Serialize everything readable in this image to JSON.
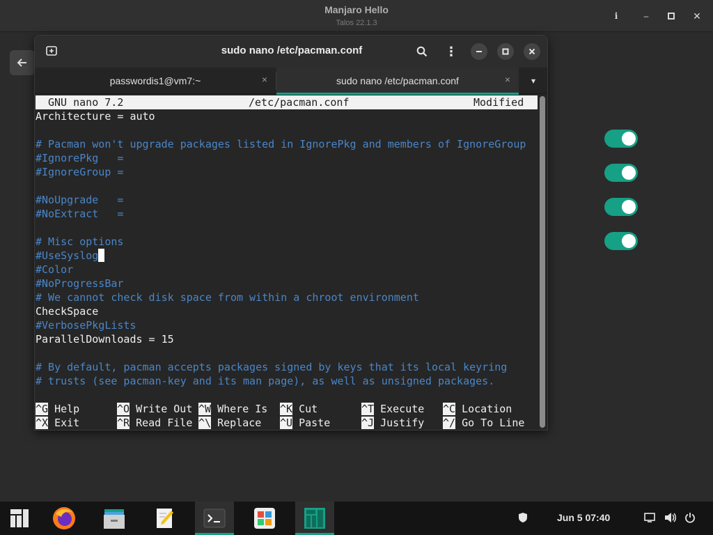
{
  "background_app": {
    "title": "Manjaro Hello",
    "subtitle": "Talos 22.1.3",
    "info_icon": "info-icon",
    "buttons": [
      "minimize-icon",
      "maximize-icon",
      "close-icon"
    ],
    "back_icon": "arrow-left-icon",
    "toggles": [
      true,
      true,
      true,
      true
    ],
    "accent_color": "#16a085"
  },
  "terminal": {
    "title": "sudo nano /etc/pacman.conf",
    "tabs": [
      {
        "label": "passwordis1@vm7:~",
        "active": false
      },
      {
        "label": "sudo nano /etc/pacman.conf",
        "active": true
      }
    ],
    "close_glyph": "×",
    "menu_glyph": "⋮",
    "dropdown_glyph": "▾"
  },
  "nano": {
    "version": "GNU nano 7.2",
    "filename": "/etc/pacman.conf",
    "status": "Modified",
    "lines": [
      {
        "text": "Architecture = auto",
        "comment": false
      },
      {
        "text": "",
        "comment": false
      },
      {
        "text": "# Pacman won't upgrade packages listed in IgnorePkg and members of IgnoreGroup",
        "comment": true
      },
      {
        "text": "#IgnorePkg   =",
        "comment": true
      },
      {
        "text": "#IgnoreGroup =",
        "comment": true
      },
      {
        "text": "",
        "comment": false
      },
      {
        "text": "#NoUpgrade   =",
        "comment": true
      },
      {
        "text": "#NoExtract   =",
        "comment": true
      },
      {
        "text": "",
        "comment": false
      },
      {
        "text": "# Misc options",
        "comment": true
      },
      {
        "text": "#UseSyslog",
        "comment": true,
        "cursor": true
      },
      {
        "text": "#Color",
        "comment": true
      },
      {
        "text": "#NoProgressBar",
        "comment": true
      },
      {
        "text": "# We cannot check disk space from within a chroot environment",
        "comment": true
      },
      {
        "text": "CheckSpace",
        "comment": false
      },
      {
        "text": "#VerbosePkgLists",
        "comment": true
      },
      {
        "text": "ParallelDownloads = 15",
        "comment": false
      },
      {
        "text": "",
        "comment": false
      },
      {
        "text": "# By default, pacman accepts packages signed by keys that its local keyring",
        "comment": true
      },
      {
        "text": "# trusts (see pacman-key and its man page), as well as unsigned packages.",
        "comment": true
      }
    ],
    "shortcuts_row1": [
      {
        "key": "^G",
        "label": "Help"
      },
      {
        "key": "^O",
        "label": "Write Out"
      },
      {
        "key": "^W",
        "label": "Where Is"
      },
      {
        "key": "^K",
        "label": "Cut"
      },
      {
        "key": "^T",
        "label": "Execute"
      },
      {
        "key": "^C",
        "label": "Location"
      }
    ],
    "shortcuts_row2": [
      {
        "key": "^X",
        "label": "Exit"
      },
      {
        "key": "^R",
        "label": "Read File"
      },
      {
        "key": "^\\",
        "label": "Replace"
      },
      {
        "key": "^U",
        "label": "Paste"
      },
      {
        "key": "^J",
        "label": "Justify"
      },
      {
        "key": "^/",
        "label": "Go To Line"
      }
    ]
  },
  "taskbar": {
    "apps": [
      {
        "name": "manjaro-menu-icon",
        "active": false
      },
      {
        "name": "firefox-icon",
        "active": false
      },
      {
        "name": "file-manager-icon",
        "active": false
      },
      {
        "name": "text-editor-icon",
        "active": false
      },
      {
        "name": "terminal-icon",
        "active": true
      },
      {
        "name": "software-center-icon",
        "active": false
      },
      {
        "name": "manjaro-hello-icon",
        "active": true
      }
    ],
    "clock": "Jun 5  07:40",
    "tray": [
      "shield-icon",
      "network-icon",
      "volume-icon",
      "power-icon"
    ]
  }
}
